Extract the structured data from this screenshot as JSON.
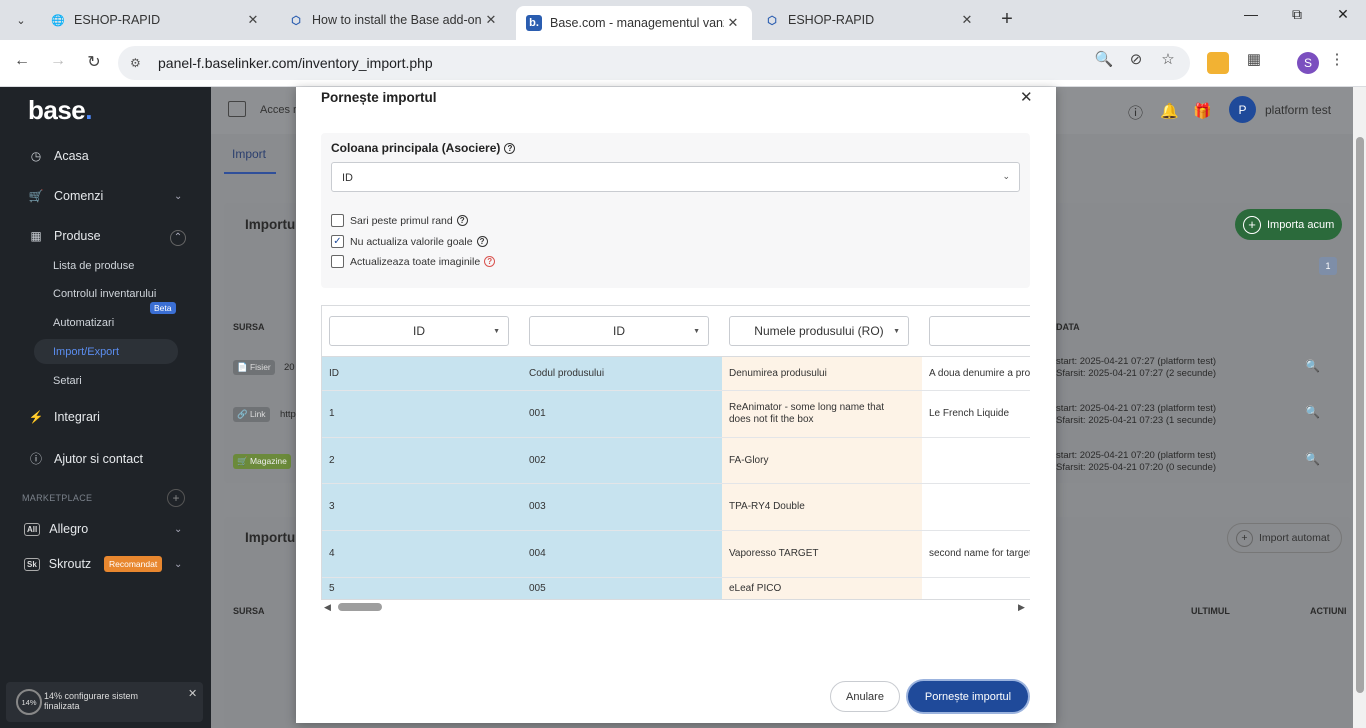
{
  "browser": {
    "tabs": [
      {
        "title": "ESHOP-RAPID"
      },
      {
        "title": "How to install the Base add-on"
      },
      {
        "title": "Base.com - managementul vanz"
      },
      {
        "title": "ESHOP-RAPID"
      }
    ],
    "url": "panel-f.baselinker.com/inventory_import.php",
    "profile_initial": "S"
  },
  "sidebar": {
    "logo": "base",
    "logo_dot": ".",
    "items": [
      {
        "label": "Acasa",
        "icon": "gauge-icon"
      },
      {
        "label": "Comenzi",
        "icon": "cart-icon"
      },
      {
        "label": "Produse",
        "icon": "box-icon"
      },
      {
        "label": "Integrari",
        "icon": "plug-icon"
      },
      {
        "label": "Ajutor si contact",
        "icon": "help-icon"
      }
    ],
    "sub_items": [
      {
        "label": "Lista de produse"
      },
      {
        "label": "Controlul inventarului"
      },
      {
        "label": "Automatizari"
      },
      {
        "label": "Import/Export"
      },
      {
        "label": "Setari"
      }
    ],
    "beta": "Beta",
    "marketplace_heading": "MARKETPLACE",
    "marketplaces": [
      {
        "badge": "All",
        "label": "Allegro"
      },
      {
        "badge": "Sk",
        "label": "Skroutz",
        "tag": "Recomandat"
      }
    ],
    "config": {
      "percent": "14%",
      "text": "14% configurare sistem finalizata"
    }
  },
  "page": {
    "acces": "Acces ra",
    "tab_import": "Import",
    "user_initial": "P",
    "user_name": "platform test",
    "card1": {
      "title": "Importu",
      "import_now": "Importa acum",
      "page": "1",
      "col_source": "SURSA",
      "col_date": "DATA",
      "rows": [
        {
          "badge": "Fisier",
          "src": "20",
          "line1": "start: 2025-04-21 07:27 (platform test)",
          "line2": "Sfarsit: 2025-04-21 07:27 (2 secunde)"
        },
        {
          "badge": "Link",
          "src": "http",
          "line1": "start: 2025-04-21 07:23 (platform test)",
          "line2": "Sfarsit: 2025-04-21 07:23 (1 secunde)"
        },
        {
          "badge": "Magazine",
          "src": "",
          "line1": "start: 2025-04-21 07:20 (platform test)",
          "line2": "Sfarsit: 2025-04-21 07:20 (0 secunde)"
        }
      ]
    },
    "card2": {
      "title": "Importu",
      "auto_import": "Import automat",
      "col_source": "SURSA",
      "col_last": "ULTIMUL",
      "col_actions": "ACTIUNI"
    }
  },
  "modal": {
    "title": "Pornește importul",
    "main_column_label": "Coloana principala (Asociere)",
    "main_column_value": "ID",
    "checkboxes": [
      {
        "label": "Sari peste primul rand",
        "checked": false
      },
      {
        "label": "Nu actualiza valorile goale",
        "checked": true
      },
      {
        "label": "Actualizeaza toate imaginile",
        "checked": false
      }
    ],
    "columns": [
      {
        "select": "ID",
        "cells": [
          "ID",
          "1",
          "2",
          "3",
          "4",
          "5"
        ]
      },
      {
        "select": "ID",
        "cells": [
          "Codul produsului",
          "001",
          "002",
          "003",
          "004",
          "005"
        ]
      },
      {
        "select": "Numele produsului (RO)",
        "cells": [
          "Denumirea produsului",
          "ReAnimator - some long name that does not fit the box",
          "FA-Glory",
          "TPA-RY4 Double",
          "Vaporesso TARGET",
          "eLeaf PICO"
        ]
      },
      {
        "select": "",
        "cells": [
          "A doua denumire a produsului",
          "Le French Liquide",
          "",
          "",
          "second name for target",
          ""
        ]
      }
    ],
    "cancel": "Anulare",
    "start": "Pornește importul"
  }
}
